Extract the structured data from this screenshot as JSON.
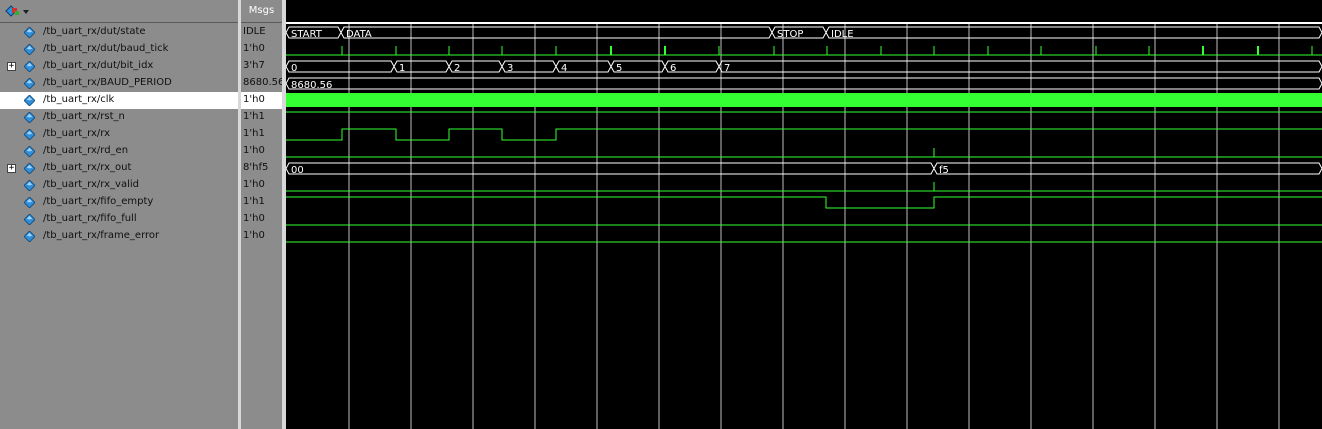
{
  "header": {
    "msgs_label": "Msgs"
  },
  "signals": [
    {
      "name": "/tb_uart_rx/dut/state",
      "value": "IDLE",
      "expandable": false
    },
    {
      "name": "/tb_uart_rx/dut/baud_tick",
      "value": "1'h0",
      "expandable": false
    },
    {
      "name": "/tb_uart_rx/dut/bit_idx",
      "value": "3'h7",
      "expandable": true
    },
    {
      "name": "/tb_uart_rx/BAUD_PERIOD",
      "value": "8680.56",
      "expandable": false
    },
    {
      "name": "/tb_uart_rx/clk",
      "value": "1'h0",
      "expandable": false,
      "selected": true
    },
    {
      "name": "/tb_uart_rx/rst_n",
      "value": "1'h1",
      "expandable": false
    },
    {
      "name": "/tb_uart_rx/rx",
      "value": "1'h1",
      "expandable": false
    },
    {
      "name": "/tb_uart_rx/rd_en",
      "value": "1'h0",
      "expandable": false
    },
    {
      "name": "/tb_uart_rx/rx_out",
      "value": "8'hf5",
      "expandable": true
    },
    {
      "name": "/tb_uart_rx/rx_valid",
      "value": "1'h0",
      "expandable": false
    },
    {
      "name": "/tb_uart_rx/fifo_empty",
      "value": "1'h1",
      "expandable": false
    },
    {
      "name": "/tb_uart_rx/fifo_full",
      "value": "1'h0",
      "expandable": false
    },
    {
      "name": "/tb_uart_rx/frame_error",
      "value": "1'h0",
      "expandable": false
    }
  ],
  "waveform": {
    "state_labels": [
      "START",
      "DATA",
      "STOP",
      "IDLE"
    ],
    "bit_idx_labels": [
      "0",
      "1",
      "2",
      "3",
      "4",
      "5",
      "6",
      "7"
    ],
    "baud_period_label": "8680.56",
    "rx_out_labels": [
      "00",
      "f5"
    ]
  },
  "colors": {
    "signal_trace": "#33ff33",
    "bus_trace": "#ffffff",
    "grid": "#e0e0e0",
    "clock_fill": "#33ff33",
    "background": "#000000",
    "panel": "#8c8c8c",
    "icon_diamond": "#2f8fd8"
  },
  "icons": {
    "toolbar": "wave-palette-icon",
    "signal": "diamond-signal-icon",
    "expand": "plus-expander-icon"
  }
}
